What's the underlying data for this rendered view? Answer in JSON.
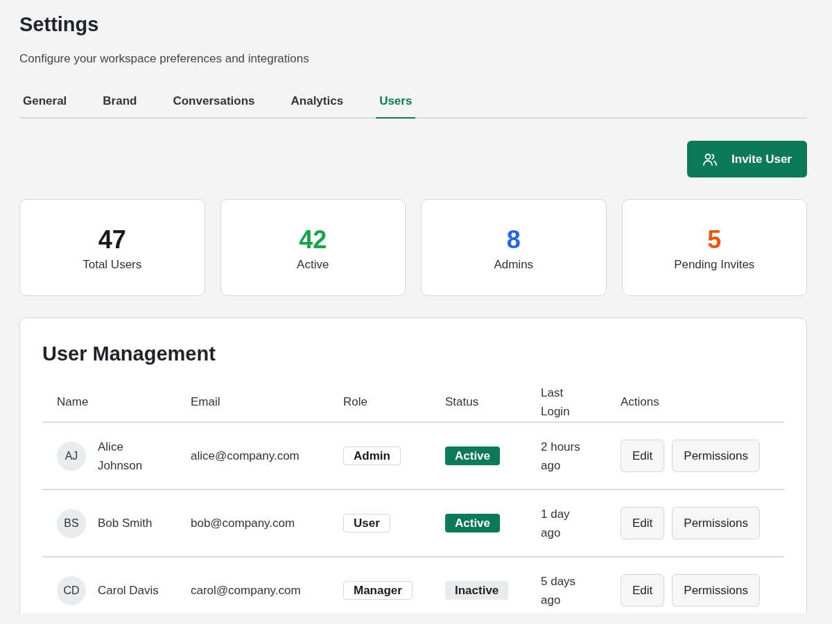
{
  "header": {
    "title": "Settings",
    "subtitle": "Configure your workspace preferences and integrations"
  },
  "tabs": [
    {
      "label": "General",
      "selected": false
    },
    {
      "label": "Brand",
      "selected": false
    },
    {
      "label": "Conversations",
      "selected": false
    },
    {
      "label": "Analytics",
      "selected": false
    },
    {
      "label": "Users",
      "selected": true
    }
  ],
  "invite_button": "Invite User",
  "stats": [
    {
      "value": "47",
      "label": "Total Users",
      "color": "#1a1a1a"
    },
    {
      "value": "42",
      "label": "Active",
      "color": "#16a34a"
    },
    {
      "value": "8",
      "label": "Admins",
      "color": "#2563eb"
    },
    {
      "value": "5",
      "label": "Pending Invites",
      "color": "#ea580c"
    }
  ],
  "user_management": {
    "title": "User Management",
    "columns": [
      "Name",
      "Email",
      "Role",
      "Status",
      "Last Login",
      "Actions"
    ],
    "rows": [
      {
        "initials": "AJ",
        "name": "Alice Johnson",
        "email": "alice@company.com",
        "role": "Admin",
        "status": "Active",
        "active": true,
        "last_login": "2 hours ago",
        "actions": [
          "Edit",
          "Permissions"
        ]
      },
      {
        "initials": "BS",
        "name": "Bob Smith",
        "email": "bob@company.com",
        "role": "User",
        "status": "Active",
        "active": true,
        "last_login": "1 day ago",
        "actions": [
          "Edit",
          "Permissions"
        ]
      },
      {
        "initials": "CD",
        "name": "Carol Davis",
        "email": "carol@company.com",
        "role": "Manager",
        "status": "Inactive",
        "active": false,
        "last_login": "5 days ago",
        "actions": [
          "Edit",
          "Permissions"
        ]
      }
    ]
  }
}
